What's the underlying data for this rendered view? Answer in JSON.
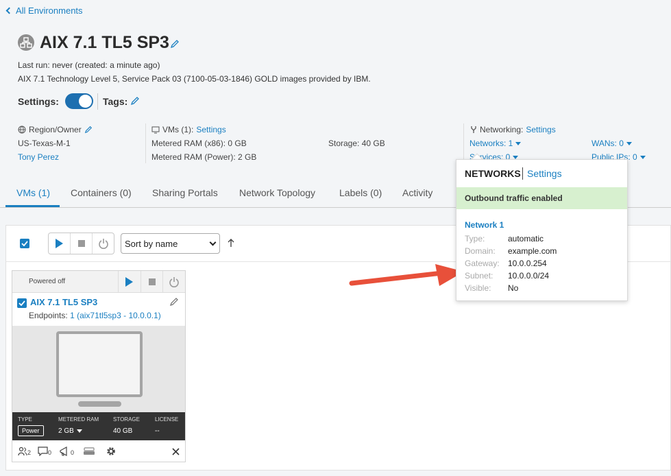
{
  "nav": {
    "back_label": "All Environments"
  },
  "header": {
    "title": "AIX 7.1 TL5 SP3",
    "last_run_label": "Last run:",
    "last_run_value": "never (created: a minute ago)",
    "description": "AIX 7.1 Technology Level 5, Service Pack 03 (7100-05-03-1846) GOLD images provided by IBM.",
    "settings_label": "Settings:",
    "tags_label": "Tags:"
  },
  "info": {
    "region_label": "Region/Owner",
    "region_value": "US-Texas-M-1",
    "owner": "Tony Perez",
    "vms_label": "VMs (1):",
    "vms_settings": "Settings",
    "ram_x86": "Metered RAM (x86): 0 GB",
    "ram_power": "Metered RAM (Power): 2 GB",
    "storage": "Storage: 40 GB",
    "networking_label": "Networking:",
    "networking_settings": "Settings",
    "networks": "Networks: 1",
    "services": "Services: 0",
    "wans": "WANs: 0",
    "public_ips": "Public IPs: 0"
  },
  "tabs": [
    "VMs (1)",
    "Containers (0)",
    "Sharing Portals",
    "Network Topology",
    "Labels (0)",
    "Activity"
  ],
  "toolbar": {
    "sort_value": "Sort by name"
  },
  "vm_card": {
    "status": "Powered off",
    "name": "AIX 7.1 TL5 SP3",
    "endpoints_label": "Endpoints:",
    "endpoints_value": "1 (aix71tl5sp3 - 10.0.0.1)",
    "type_label": "TYPE",
    "type_value": "Power",
    "ram_label": "METERED RAM",
    "ram_value": "2 GB",
    "storage_label": "STORAGE",
    "storage_value": "40 GB",
    "license_label": "LICENSE",
    "license_value": "--",
    "users_count": "2",
    "comments_count": "0",
    "alerts_count": "0"
  },
  "popover": {
    "title": "NETWORKS",
    "settings": "Settings",
    "banner": "Outbound traffic enabled",
    "network_name": "Network 1",
    "rows": [
      {
        "key": "Type:",
        "value": "automatic"
      },
      {
        "key": "Domain:",
        "value": "example.com"
      },
      {
        "key": "Gateway:",
        "value": "10.0.0.254"
      },
      {
        "key": "Subnet:",
        "value": "10.0.0.0/24"
      },
      {
        "key": "Visible:",
        "value": "No"
      }
    ]
  },
  "colors": {
    "accent": "#1a7fc1",
    "toggle": "#1d6fb0",
    "banner": "#d7f0cf",
    "annotation_arrow": "#e8503a"
  }
}
